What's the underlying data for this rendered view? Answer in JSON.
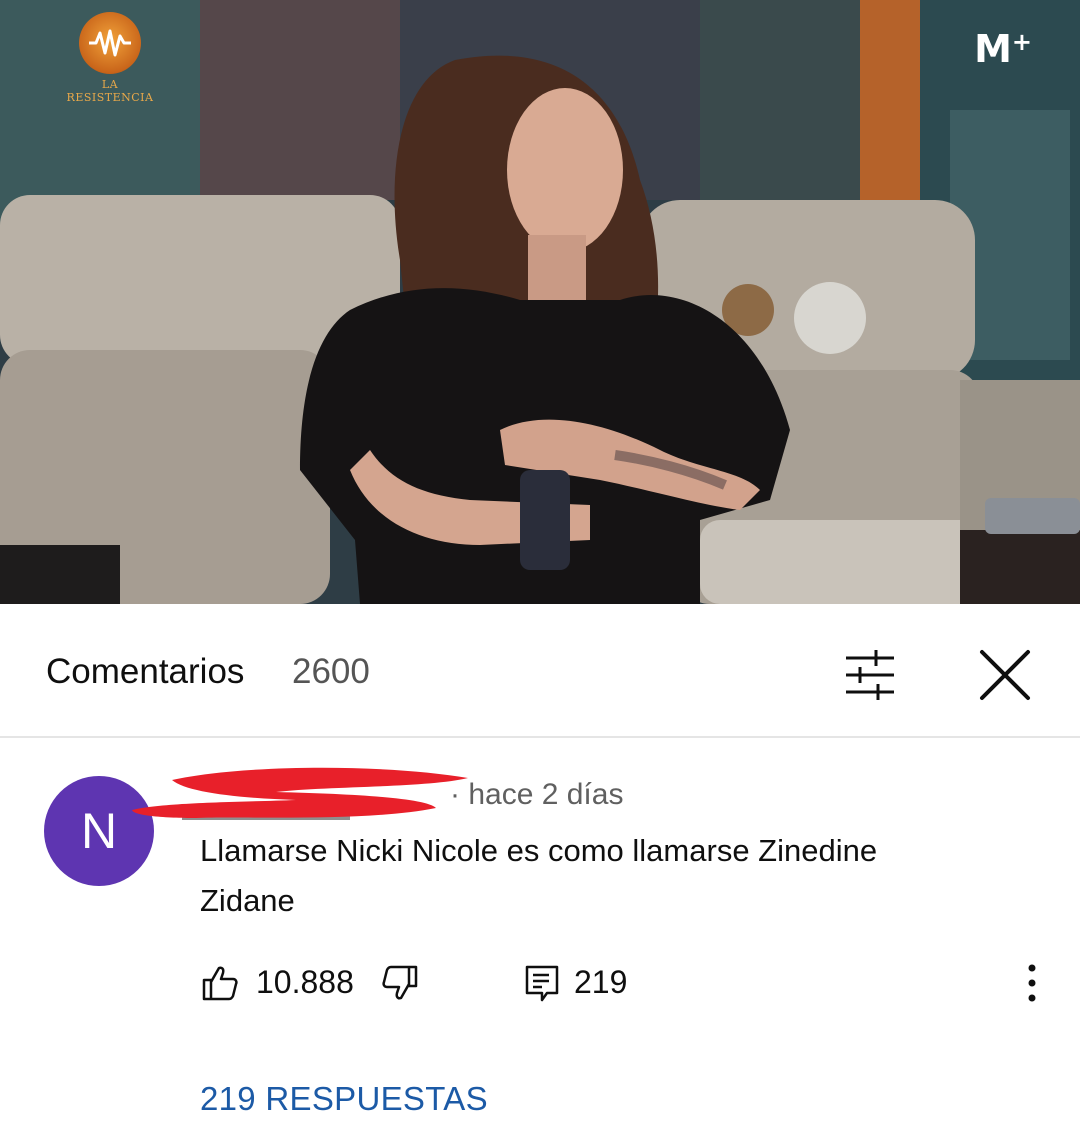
{
  "video": {
    "show_logo_text": "LA RESISTENCIA",
    "channel_logo": "M",
    "channel_logo_plus": "+"
  },
  "comments": {
    "title": "Comentarios",
    "count": "2600",
    "sort_icon": "sort-filter-icon",
    "close_icon": "close-icon"
  },
  "comment": {
    "avatar_letter": "N",
    "timestamp": "· hace 2 días",
    "text": "Llamarse Nicki Nicole es como llamarse Zinedine Zidane",
    "likes": "10.888",
    "reply_count": "219",
    "replies_link": "219 RESPUESTAS"
  },
  "colors": {
    "avatar": "#5e35b1",
    "link": "#1c5aa6",
    "redaction": "#e8202a"
  }
}
